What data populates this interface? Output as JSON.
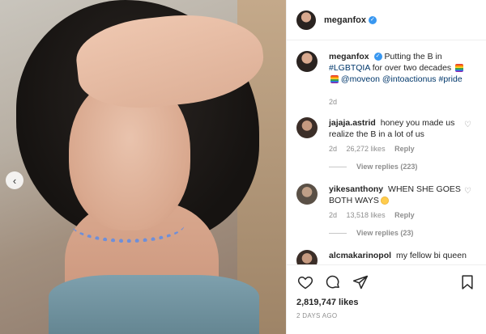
{
  "post_author": {
    "username": "meganfox",
    "verified": true
  },
  "caption": {
    "username": "meganfox",
    "text": "Putting the B in",
    "hashtag_lgbt": "#LGBTQIA",
    "text2": "for over two decades",
    "emoji": "rainbow-flag",
    "mention1": "@moveon",
    "mention2": "@intoactionus",
    "hashtag_pride": "#pride",
    "age": "2d"
  },
  "comments": [
    {
      "username": "jajaja.astrid",
      "text": "honey you made us realize the B in a lot of us",
      "age": "2d",
      "likes": "26,272 likes",
      "reply": "Reply",
      "view_replies": "View replies (223)"
    },
    {
      "username": "yikesanthony",
      "text": "WHEN SHE GOES BOTH WAYS",
      "emoji": "heart-eyes-face",
      "age": "2d",
      "likes": "13,518 likes",
      "reply": "Reply",
      "view_replies": "View replies (23)"
    },
    {
      "username": "alcmakarinopol",
      "text": "my fellow bi queen"
    }
  ],
  "footer": {
    "likes": "2,819,747 likes",
    "timestamp": "2 DAYS AGO"
  },
  "icons": {
    "like": "heart-icon",
    "comment": "comment-icon",
    "share": "share-icon",
    "save": "bookmark-icon",
    "carousel_prev": "chevron-left-icon",
    "verified": "verified-badge-icon"
  },
  "colors": {
    "link": "#00376b",
    "verified": "#3897f0",
    "muted": "#8e8e8e"
  }
}
